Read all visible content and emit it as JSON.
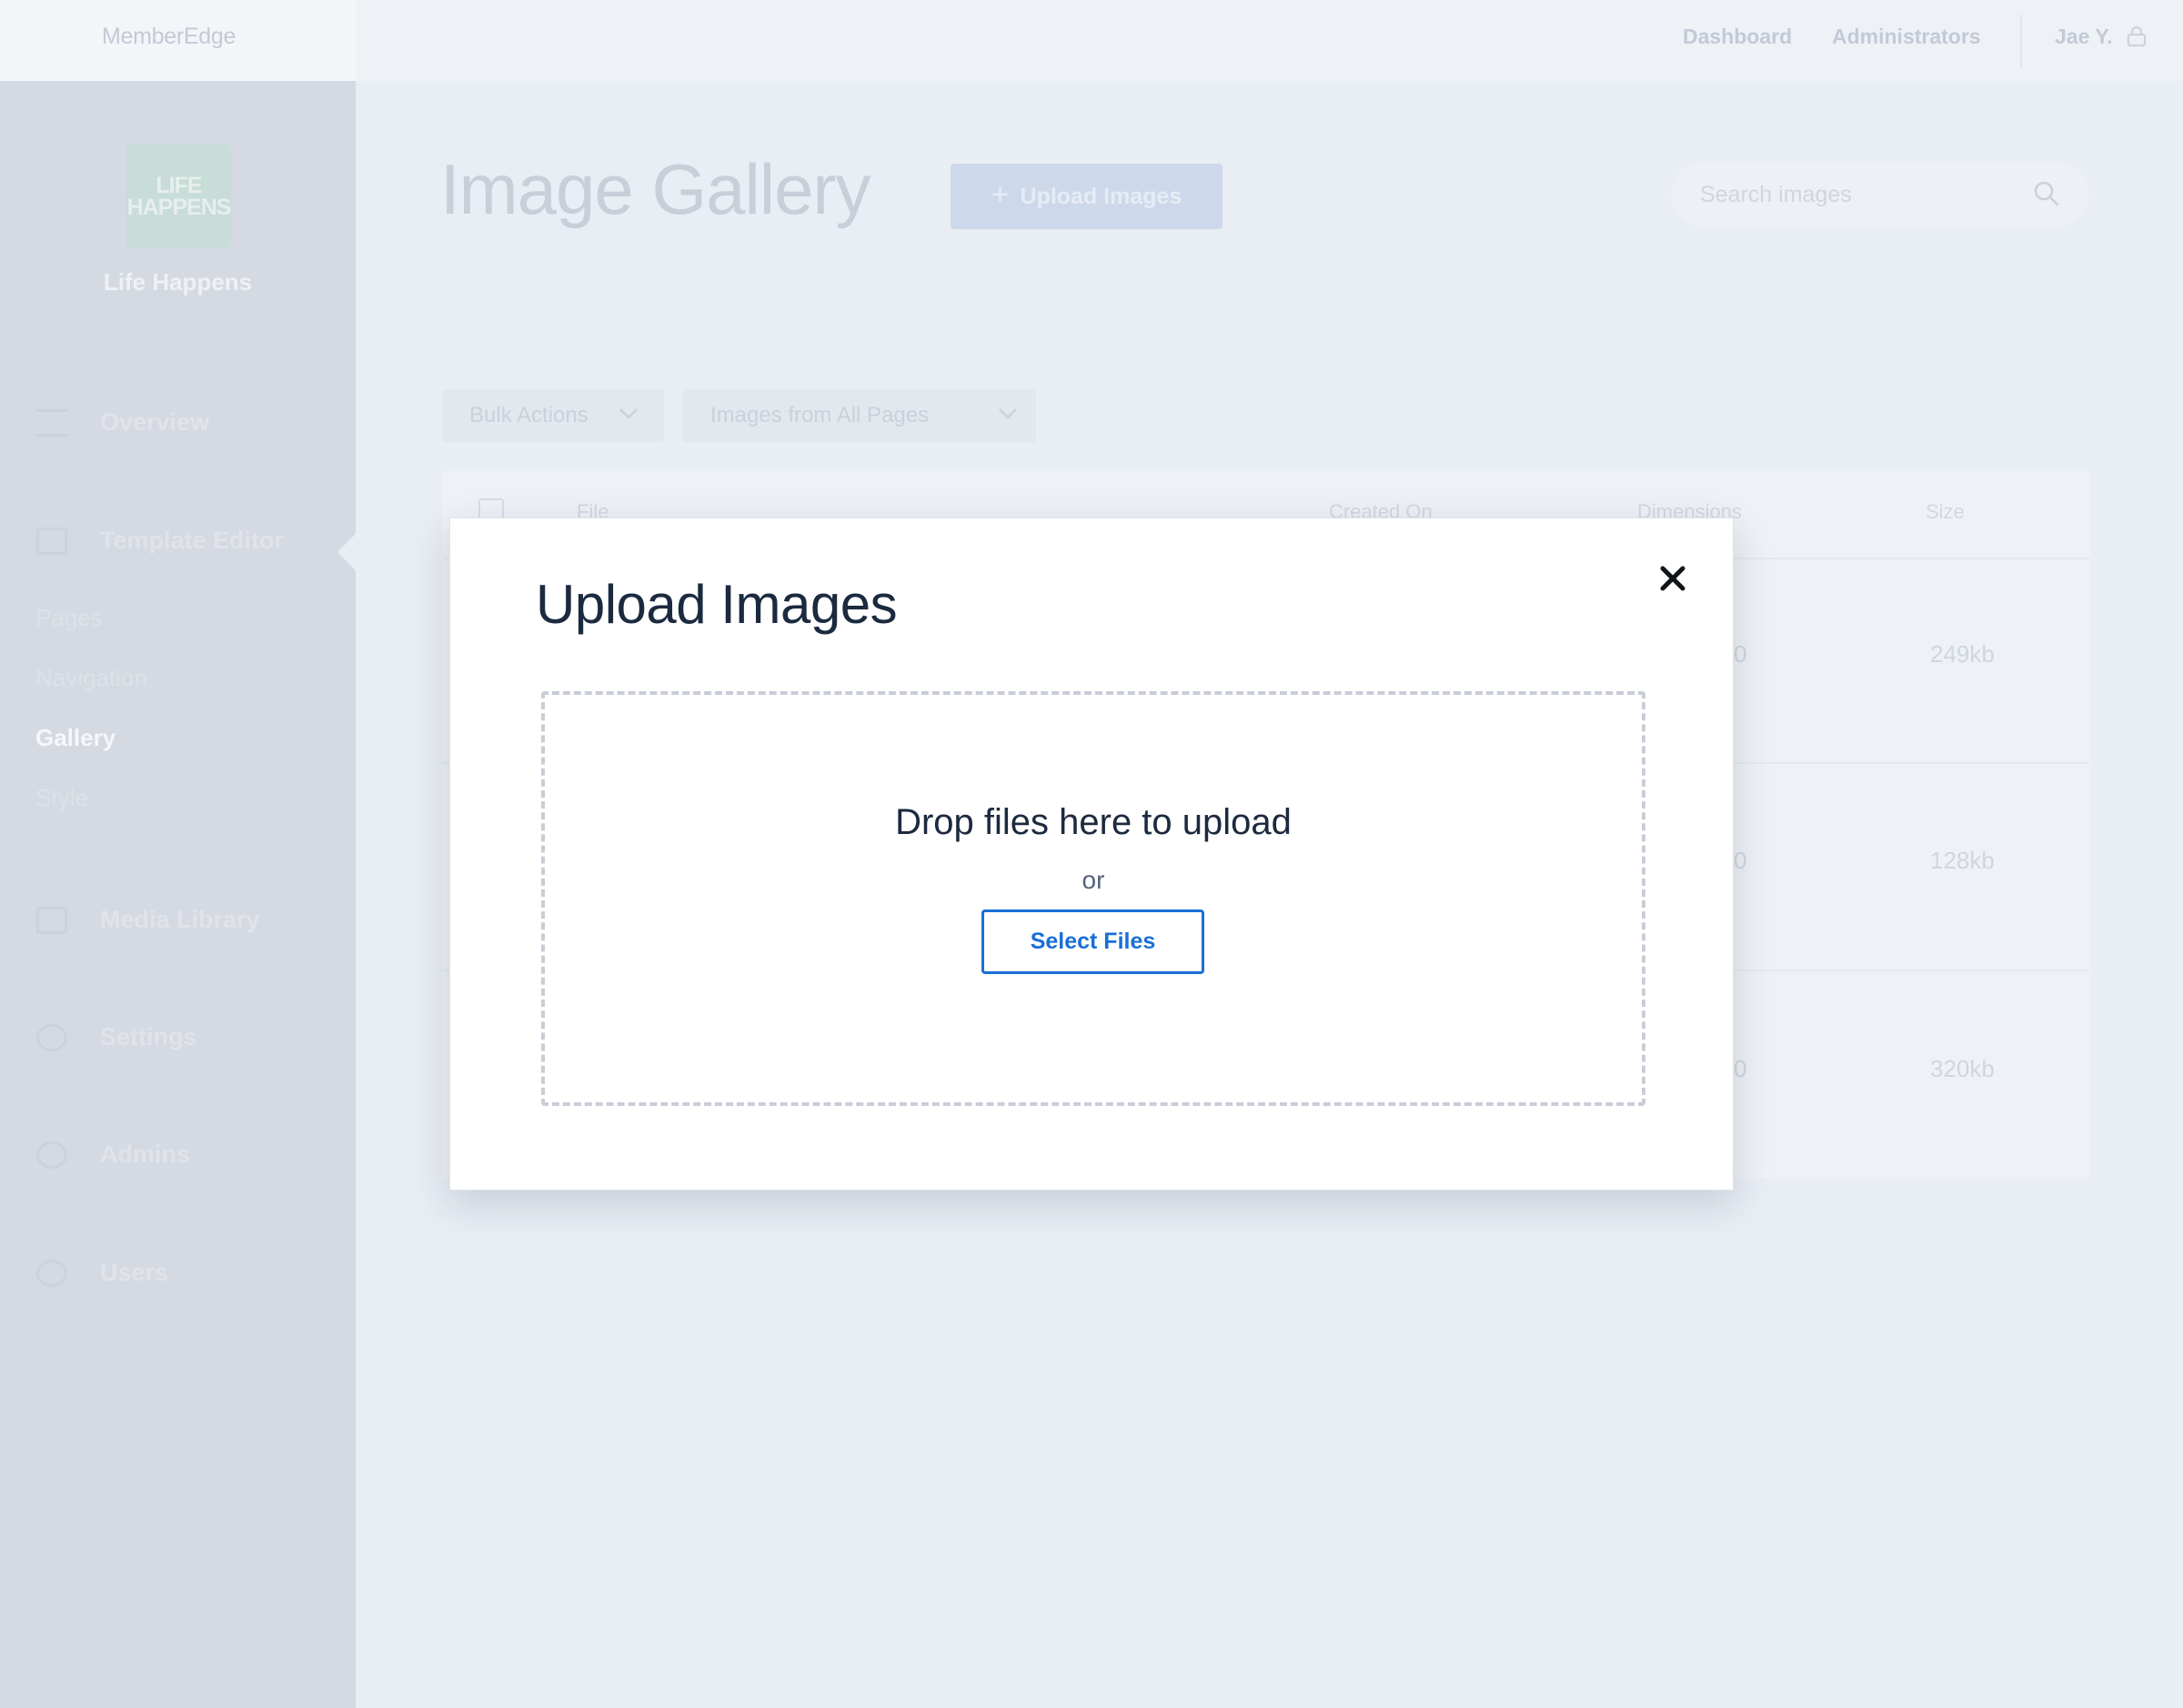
{
  "topbar": {
    "brand": "MemberEdge",
    "links": [
      "Dashboard",
      "Administrators"
    ],
    "user": "Jae Y."
  },
  "sidebar": {
    "logo_text": "LIFE HAPPENS",
    "org_name": "Life Happens",
    "items": {
      "overview": "Overview",
      "template_editor": "Template Editor",
      "media_library": "Media Library",
      "settings": "Settings",
      "admins": "Admins",
      "users": "Users"
    },
    "sub_items": [
      "Pages",
      "Navigation",
      "Gallery",
      "Style"
    ],
    "active_sub_item": "Gallery"
  },
  "main": {
    "title": "Image Gallery",
    "upload_button": "Upload Images",
    "search_placeholder": "Search images",
    "bulk_actions": "Bulk Actions",
    "filter": "Images from All Pages",
    "table": {
      "columns": [
        "File",
        "Created On",
        "Dimensions",
        "Size"
      ],
      "rows": [
        {
          "dimensions": "0",
          "size": "249kb"
        },
        {
          "dimensions": "0",
          "size": "128kb"
        },
        {
          "dimensions": "0",
          "size": "320kb"
        }
      ]
    }
  },
  "modal": {
    "title": "Upload Images",
    "drop_text": "Drop files here to upload",
    "or_text": "or",
    "select_button": "Select Files"
  },
  "colors": {
    "accent": "#1a6fd6",
    "overlay_background": "#e9edf4",
    "sidebar_background": "#d5d9e1",
    "modal_text": "#1c2a3f"
  },
  "icons": {
    "close": "close-icon",
    "search": "search-icon",
    "lock": "lock-icon",
    "plus": "plus-icon",
    "chevron": "chevron-down-icon"
  }
}
